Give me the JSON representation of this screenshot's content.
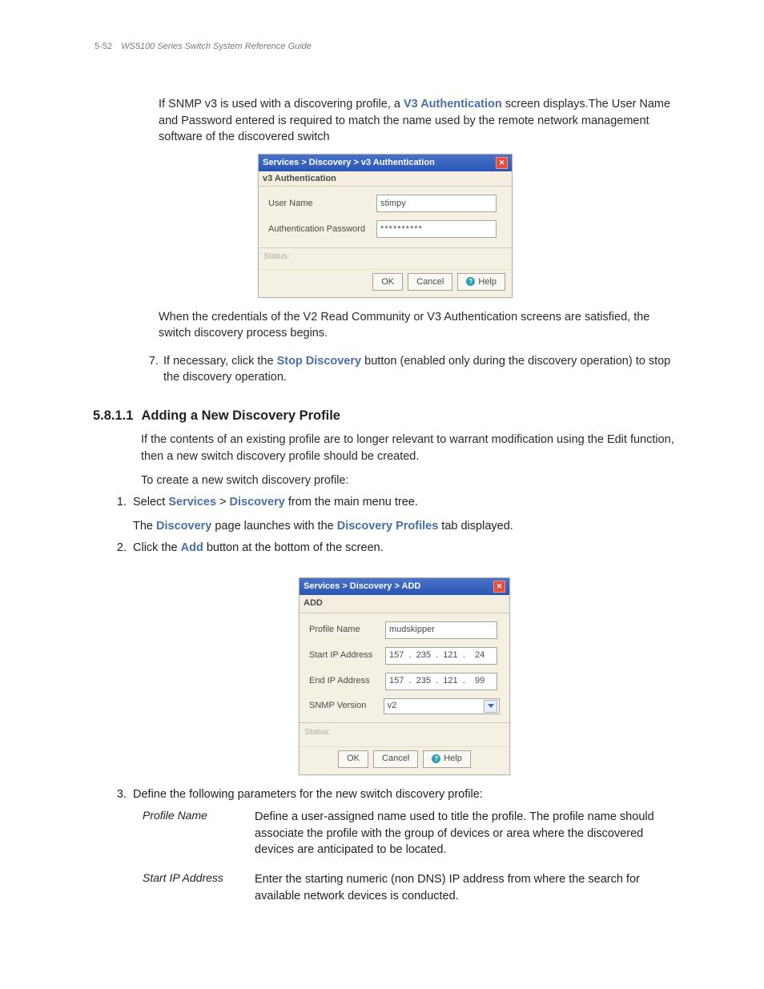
{
  "header": {
    "page_num": "5-52",
    "guide": "WS5100 Series Switch System Reference Guide"
  },
  "intro": {
    "p1_pre": "If SNMP v3 is used with a discovering profile, a ",
    "p1_link": "V3 Authentication",
    "p1_post": " screen displays.The User Name and Password entered is required to match the name used by the remote network management software of the discovered switch"
  },
  "dialog1": {
    "title": "Services  > Discovery > v3 Authentication",
    "subtitle": "v3 Authentication",
    "user_label": "User Name",
    "user_value": "stimpy",
    "pass_label": "Authentication Password",
    "pass_value": "**********",
    "status": "Status:",
    "ok": "OK",
    "cancel": "Cancel",
    "help": "Help"
  },
  "p2": "When the credentials of the V2 Read Community or V3 Authentication screens are satisfied, the switch discovery process begins.",
  "step7": {
    "num": "7.",
    "pre": "If necessary, click the ",
    "link": "Stop Discovery",
    "post": " button (enabled only during the discovery operation) to stop the discovery operation."
  },
  "section": {
    "num": "5.8.1.1",
    "title": "Adding a New Discovery Profile"
  },
  "sec_p1": "If the contents of an existing profile are to longer relevant to warrant modification using the Edit function, then a new switch discovery profile should be created.",
  "sec_p2": "To create a new switch discovery profile:",
  "steps": {
    "s1_pre": "Select ",
    "s1_a": "Services",
    "s1_gt": " > ",
    "s1_b": "Discovery",
    "s1_post": " from the main menu tree.",
    "s1b_pre": "The ",
    "s1b_a": "Discovery",
    "s1b_mid": " page launches with the ",
    "s1b_b": "Discovery Profiles",
    "s1b_post": " tab displayed.",
    "s2_pre": "Click the ",
    "s2_a": "Add",
    "s2_post": " button at the bottom of the screen.",
    "s3": "Define the following parameters for the new switch discovery profile:"
  },
  "dialog2": {
    "title": "Services  > Discovery > ADD",
    "subtitle": "ADD",
    "profile_label": "Profile Name",
    "profile_value": "mudskipper",
    "sip_label": "Start IP Address",
    "sip_value": "157  .  235  .  121  .    24",
    "eip_label": "End IP Address",
    "eip_value": "157  .  235  .  121  .    99",
    "snmp_label": "SNMP Version",
    "snmp_value": "v2",
    "status": "Status:",
    "ok": "OK",
    "cancel": "Cancel",
    "help": "Help"
  },
  "params": {
    "pn_label": "Profile Name",
    "pn_desc": "Define a user-assigned name used to title the profile. The profile name should associate the profile with the group of devices or area where the discovered devices are anticipated to be located.",
    "sip_label": "Start IP Address",
    "sip_desc": "Enter the starting numeric (non DNS) IP address from where the search for available network devices is conducted."
  }
}
